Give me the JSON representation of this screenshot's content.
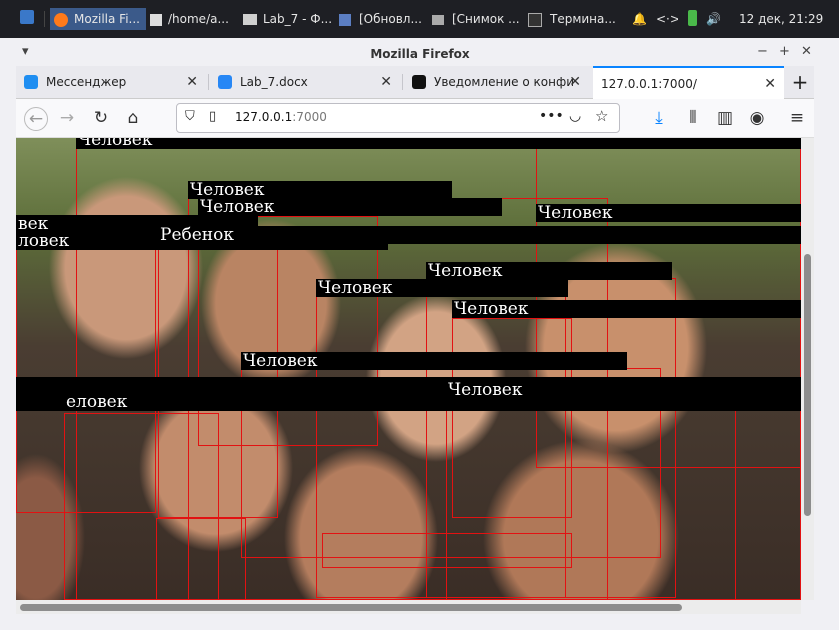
{
  "taskbar": {
    "items": [
      "Mozilla Fi...",
      "/home/a...",
      "Lab_7 - Ф...",
      "[Обновл...",
      "[Снимок ...",
      "Термина..."
    ],
    "clock": "12 дек, 21:29"
  },
  "window": {
    "title": "Mozilla Firefox"
  },
  "tabs": [
    {
      "label": "Мессенджер",
      "icon": "messenger-icon"
    },
    {
      "label": "Lab_7.docx",
      "icon": "vk-icon"
    },
    {
      "label": "Уведомление о конфи",
      "icon": "m-icon"
    },
    {
      "label": "127.0.0.1:7000/",
      "icon": ""
    }
  ],
  "url": {
    "host": "127.0.0.1",
    "port": ":7000"
  },
  "labels": {
    "l1": "Человек",
    "l2": "Человек",
    "l3": "Человек",
    "l4": "Человек",
    "l5": "век",
    "l6": "ловек",
    "l7": "Ребенок",
    "l8": "Человек",
    "l9": "Человек",
    "l10": "Человек",
    "l11": "Человек",
    "l12": "еловек",
    "l13": "Человек"
  }
}
